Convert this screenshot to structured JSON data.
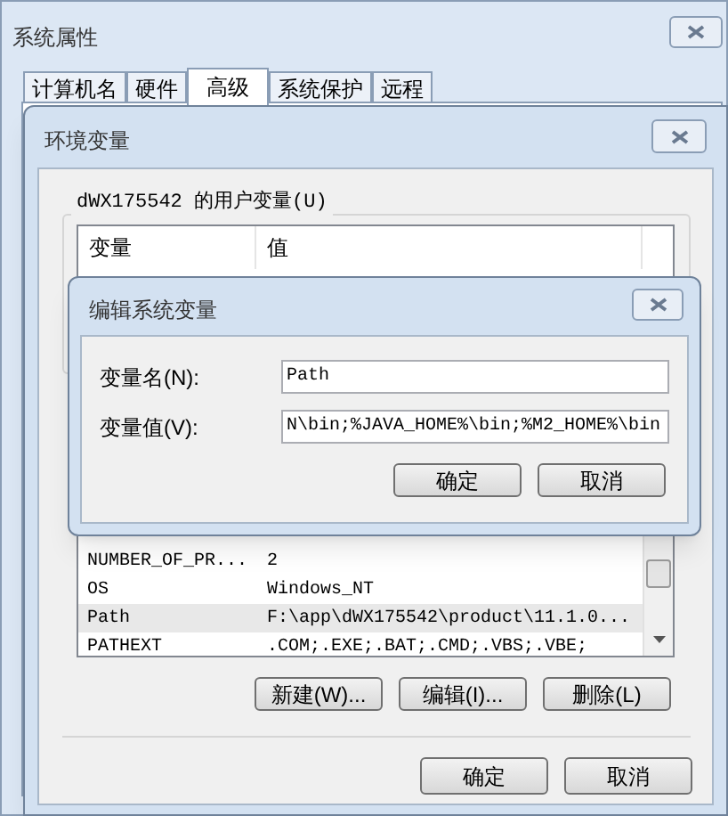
{
  "window": {
    "title": "系统属性"
  },
  "tabs": [
    {
      "label": "计算机名",
      "selected": false
    },
    {
      "label": "硬件",
      "selected": false
    },
    {
      "label": "高级",
      "selected": true
    },
    {
      "label": "系统保护",
      "selected": false
    },
    {
      "label": "远程",
      "selected": false
    }
  ],
  "env_window": {
    "title": "环境变量",
    "user_group": "dWX175542 的用户变量(U)",
    "user_columns": [
      "变量",
      "值"
    ],
    "system_rows": [
      {
        "name": "NUMBER_OF_PR...",
        "value": "2",
        "selected": false
      },
      {
        "name": "OS",
        "value": "Windows_NT",
        "selected": false
      },
      {
        "name": "Path",
        "value": "F:\\app\\dWX175542\\product\\11.1.0...",
        "selected": true
      },
      {
        "name": "PATHEXT",
        "value": ".COM;.EXE;.BAT;.CMD;.VBS;.VBE;",
        "selected": false
      }
    ],
    "system_buttons": [
      "新建(W)...",
      "编辑(I)...",
      "删除(L)"
    ],
    "buttons": [
      "确定",
      "取消"
    ]
  },
  "edit_dialog": {
    "title": "编辑系统变量",
    "fields": [
      {
        "label": "变量名(N):",
        "value": "Path"
      },
      {
        "label": "变量值(V):",
        "value": "N\\bin;%JAVA_HOME%\\bin;%M2_HOME%\\bin"
      }
    ],
    "buttons": [
      "确定",
      "取消"
    ]
  }
}
